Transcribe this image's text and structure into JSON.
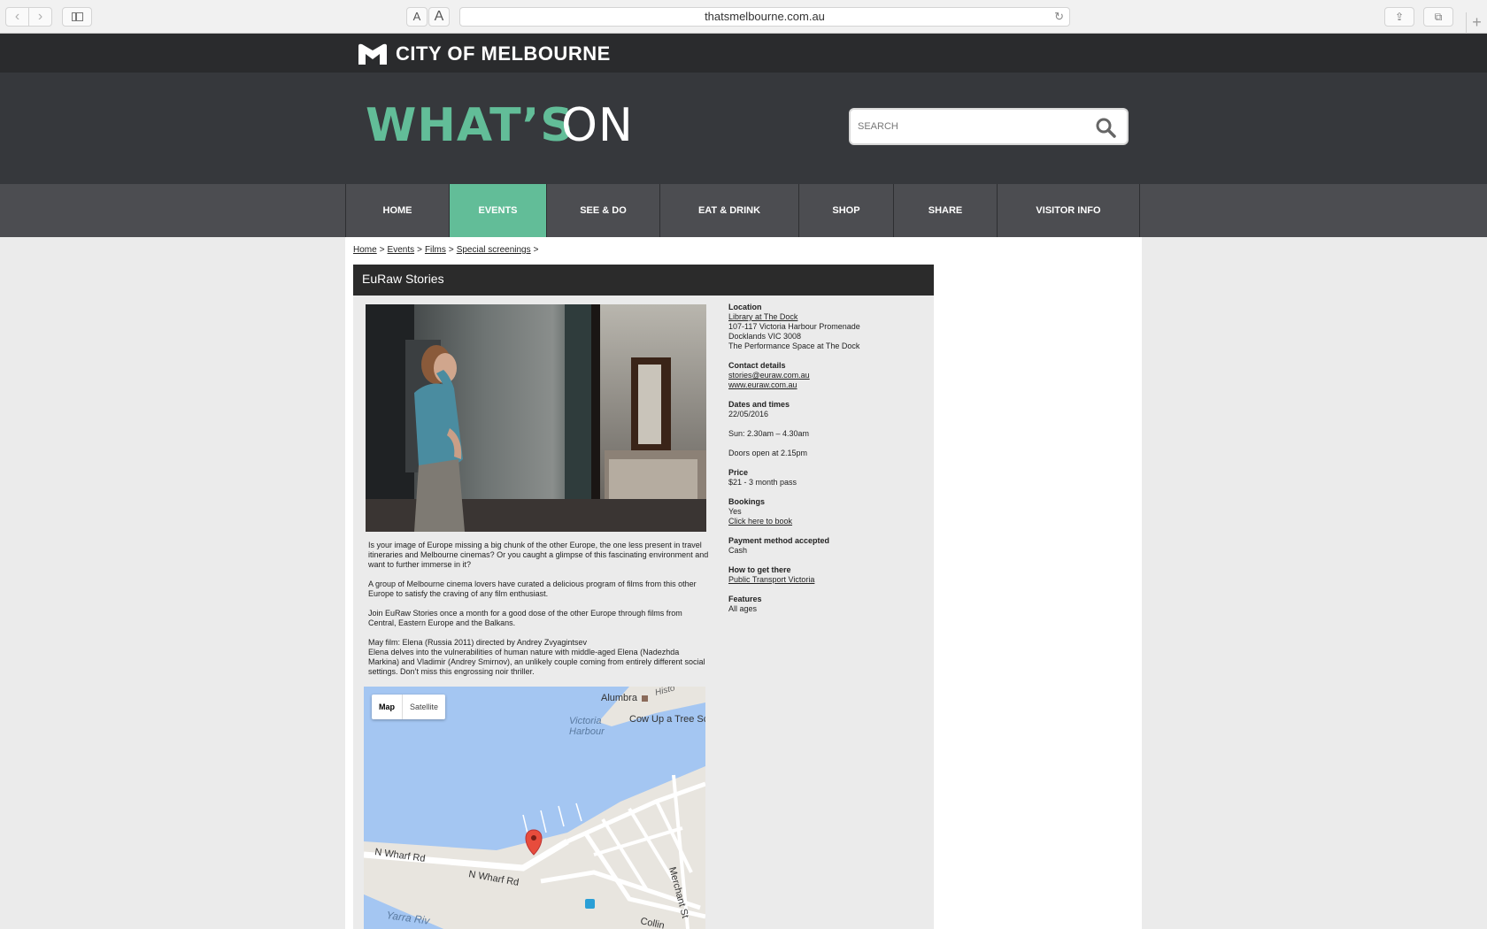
{
  "browser": {
    "url": "thatsmelbourne.com.au",
    "back_glyph": "‹",
    "forward_glyph": "›",
    "font_small": "A",
    "font_large": "A",
    "reload_glyph": "↻",
    "share_glyph": "⇪",
    "tabs_glyph": "⧉",
    "newtab_glyph": "+"
  },
  "site": {
    "logo_text": "CITY OF MELBOURNE",
    "hero_title_accent": "WHAT’S",
    "hero_title_rest": "ON",
    "search_placeholder": "SEARCH",
    "accent_color": "#62bd98"
  },
  "nav": {
    "items": [
      {
        "label": "HOME"
      },
      {
        "label": "EVENTS"
      },
      {
        "label": "SEE & DO"
      },
      {
        "label": "EAT & DRINK"
      },
      {
        "label": "SHOP"
      },
      {
        "label": "SHARE"
      },
      {
        "label": "VISITOR INFO"
      }
    ],
    "active": "EVENTS"
  },
  "breadcrumb": {
    "items": [
      "Home",
      "Events",
      "Films",
      "Special screenings"
    ],
    "separator": ">"
  },
  "event": {
    "title": "EuRaw Stories",
    "description": [
      "Is your image of Europe missing a big chunk of the other Europe, the one less present in travel itineraries and Melbourne cinemas? Or you caught a glimpse of this fascinating environment and want to further immerse in it?",
      "A group of Melbourne cinema lovers have curated a delicious program of films from this other Europe to satisfy the craving of any film enthusiast.",
      "Join EuRaw Stories once a month for a good dose of the other Europe through films from Central, Eastern Europe and the Balkans.",
      "May film: Elena (Russia 2011) directed by Andrey Zvyagintsev",
      "Elena delves into the vulnerabilities of human nature with middle-aged Elena (Nadezhda Markina) and Vladimir (Andrey Smirnov), an unlikely couple coming from entirely different social settings. Don’t miss this engrossing noir thriller."
    ],
    "details": {
      "location_label": "Location",
      "location_link": "Library at The Dock",
      "address1": "107-117 Victoria Harbour Promenade",
      "address2": "Docklands VIC 3008",
      "venue": "The Performance Space at The Dock",
      "contact_label": "Contact details",
      "email": "stories@euraw.com.au",
      "website": "www.euraw.com.au",
      "dates_label": "Dates and times",
      "date": "22/05/2016",
      "time": "Sun: 2.30am – 4.30am",
      "doors": "Doors open at 2.15pm",
      "price_label": "Price",
      "price": "$21 - 3 month pass",
      "bookings_label": "Bookings",
      "bookings": "Yes",
      "book_link": "Click here to book",
      "payment_label": "Payment method accepted",
      "payment": "Cash",
      "transport_label": "How to get there",
      "transport_link": "Public Transport Victoria",
      "features_label": "Features",
      "features": "All ages"
    }
  },
  "map": {
    "tab_map": "Map",
    "tab_satellite": "Satellite",
    "labels": {
      "alumbra": "Alumbra",
      "histo": "Histo",
      "victoria": "Victoria",
      "harbour": "Harbour",
      "cowup": "Cow Up a Tree Sc",
      "nwharf1": "N Wharf Rd",
      "nwharf2": "N Wharf Rd",
      "merchant": "Merchant St",
      "yarra": "Yarra Riv",
      "collins": "Collin"
    }
  }
}
